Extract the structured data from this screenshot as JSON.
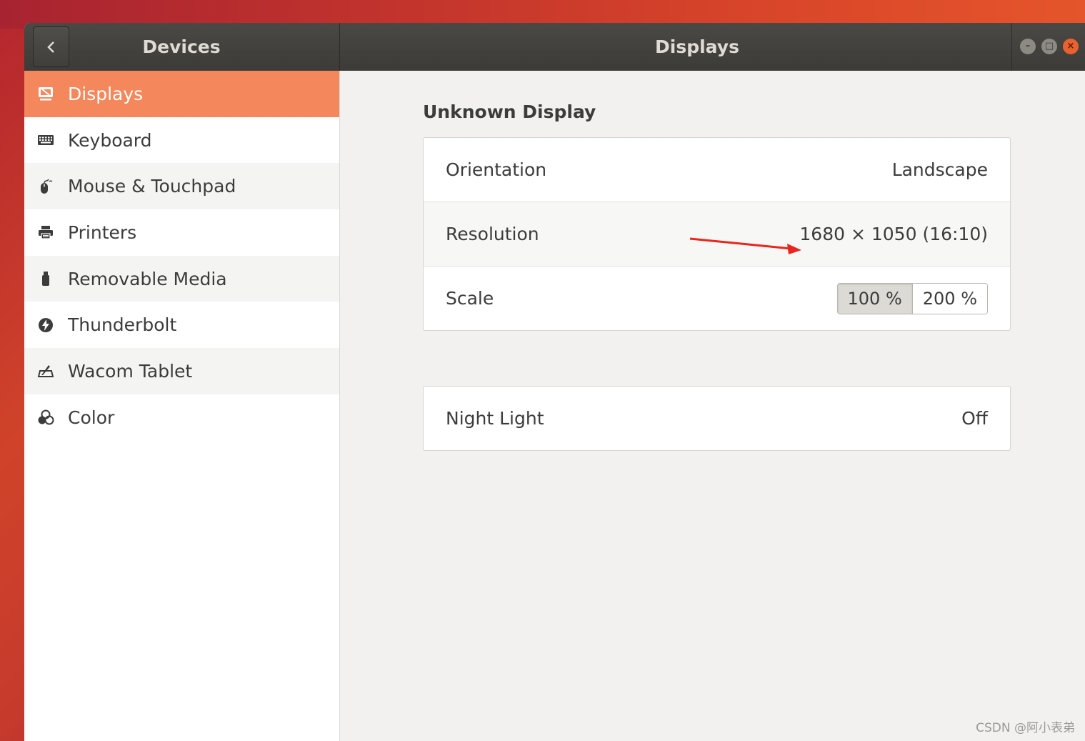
{
  "window": {
    "panel_title": "Devices",
    "main_title": "Displays",
    "controls": {
      "minimize": "–",
      "maximize": "□",
      "close": "×"
    },
    "back_icon": "chevron-left-icon"
  },
  "sidebar": {
    "items": [
      {
        "label": "Displays",
        "icon": "display-icon",
        "active": true
      },
      {
        "label": "Keyboard",
        "icon": "keyboard-icon"
      },
      {
        "label": "Mouse & Touchpad",
        "icon": "mouse-icon"
      },
      {
        "label": "Printers",
        "icon": "printer-icon"
      },
      {
        "label": "Removable Media",
        "icon": "usb-drive-icon"
      },
      {
        "label": "Thunderbolt",
        "icon": "thunderbolt-icon"
      },
      {
        "label": "Wacom Tablet",
        "icon": "tablet-icon"
      },
      {
        "label": "Color",
        "icon": "color-icon"
      }
    ]
  },
  "content": {
    "section_title": "Unknown Display",
    "display_card": {
      "orientation": {
        "label": "Orientation",
        "value": "Landscape"
      },
      "resolution": {
        "label": "Resolution",
        "value": "1680 × 1050 (16:10)"
      },
      "scale": {
        "label": "Scale",
        "options": [
          "100 %",
          "200 %"
        ],
        "selected": "100 %"
      }
    },
    "night_light": {
      "label": "Night Light",
      "value": "Off"
    }
  },
  "annotation": {
    "arrow_color": "#e8261c"
  },
  "watermark": "CSDN @阿小表弟",
  "colors": {
    "accent": "#f4875b",
    "titlebar": "#3c3b37",
    "close": "#e9612f"
  }
}
